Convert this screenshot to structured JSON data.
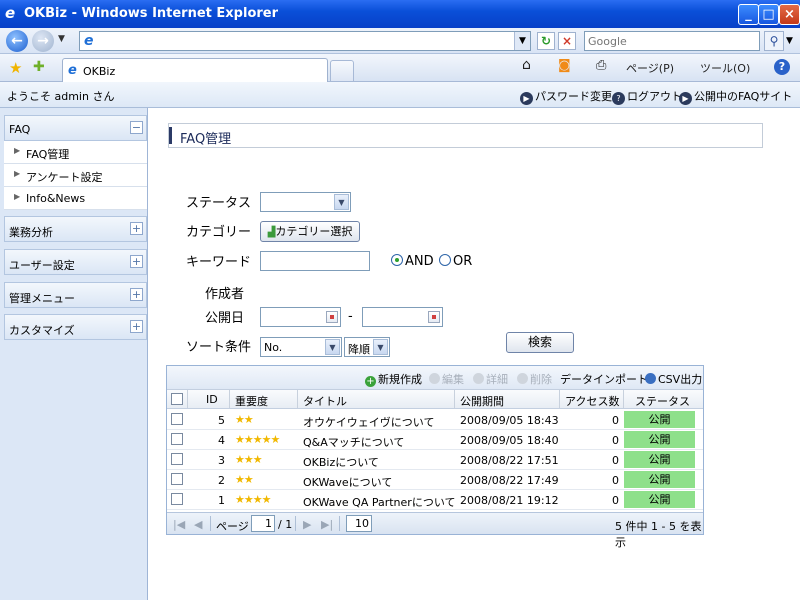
{
  "window": {
    "title": "OKBiz - Windows Internet Explorer",
    "search_placeholder": "Google",
    "tab_label": "OKBiz",
    "cmd_page": "ページ(P)",
    "cmd_tools": "ツール(O)"
  },
  "header": {
    "welcome": "ようこそ admin さん",
    "password_change": "パスワード変更",
    "logout": "ログアウト",
    "public_faq_site": "公開中のFAQサイトへ"
  },
  "sidebar": {
    "sections": [
      {
        "label": "FAQ",
        "expanded": true,
        "toggle": "−",
        "items": [
          "FAQ管理",
          "アンケート設定",
          "Info&News"
        ]
      },
      {
        "label": "業務分析",
        "toggle": "+"
      },
      {
        "label": "ユーザー設定",
        "toggle": "+"
      },
      {
        "label": "管理メニュー",
        "toggle": "+"
      },
      {
        "label": "カスタマイズ",
        "toggle": "+"
      }
    ]
  },
  "page": {
    "title": "FAQ管理"
  },
  "filters": {
    "status_label": "ステータス",
    "status_value": "",
    "category_label": "カテゴリー",
    "category_button": "カテゴリー選択",
    "keyword_label": "キーワード",
    "keyword_value": "",
    "and_label": "AND",
    "or_label": "OR",
    "and_selected": true,
    "author_label": "作成者",
    "pubdate_label": "公開日",
    "date_from": "",
    "date_separator": "-",
    "date_to": "",
    "sort_label": "ソート条件",
    "sort_field": "No.",
    "sort_order": "降順",
    "search_button": "検索"
  },
  "grid": {
    "toolbar": {
      "new": "新規作成",
      "edit": "編集",
      "detail": "詳細",
      "delete": "削除",
      "import": "データインポート",
      "csv": "CSV出力"
    },
    "columns": [
      "ID",
      "重要度",
      "タイトル",
      "公開期間",
      "アクセス数",
      "ステータス"
    ],
    "rows": [
      {
        "id": "5",
        "stars": "★★",
        "title": "オウケイウェイヴについて",
        "period": "2008/09/05 18:43",
        "access": "0",
        "status": "公開"
      },
      {
        "id": "4",
        "stars": "★★★★★",
        "title": "Q&Aマッチについて",
        "period": "2008/09/05 18:40",
        "access": "0",
        "status": "公開"
      },
      {
        "id": "3",
        "stars": "★★★",
        "title": "OKBizについて",
        "period": "2008/08/22 17:51",
        "access": "0",
        "status": "公開"
      },
      {
        "id": "2",
        "stars": "★★",
        "title": "OKWaveについて",
        "period": "2008/08/22 17:49",
        "access": "0",
        "status": "公開"
      },
      {
        "id": "1",
        "stars": "★★★★",
        "title": "OKWave  QA Partnerについて",
        "period": "2008/08/21 19:12",
        "access": "0",
        "status": "公開"
      }
    ],
    "footer": {
      "page_label": "ページ",
      "page_value": "1",
      "page_total": "/ 1",
      "per_page": "10",
      "summary": "5 件中 1 - 5 を表示"
    }
  },
  "colors": {
    "titlebar": "#0a4fd8",
    "sidebar_bg": "#dce7f6",
    "status_public": "#8ee08a",
    "star": "#f1b800"
  }
}
